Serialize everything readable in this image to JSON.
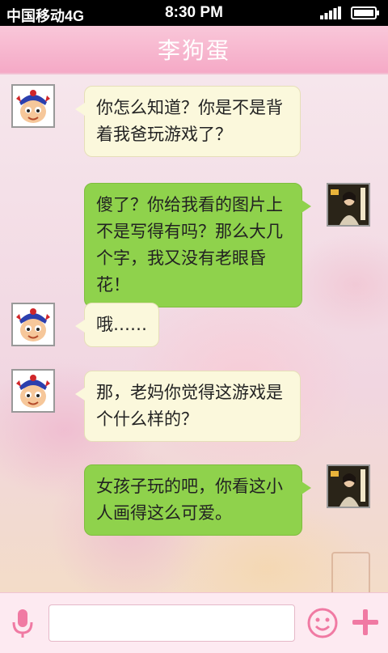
{
  "status_bar": {
    "carrier": "中国移动4G",
    "time": "8:30 PM"
  },
  "header": {
    "title": "李狗蛋"
  },
  "messages": [
    {
      "side": "in",
      "text": "你怎么知道？你是不是背着我爸玩游戏了？"
    },
    {
      "side": "out",
      "text": "傻了？你给我看的图片上不是写得有吗？那么大几个字，我又没有老眼昏花！"
    },
    {
      "side": "in",
      "text": "哦……"
    },
    {
      "side": "in",
      "text": "那，老妈你觉得这游戏是个什么样的？"
    },
    {
      "side": "out",
      "text": "女孩子玩的吧，你看这小人画得这么可爱。"
    }
  ],
  "input": {
    "value": "",
    "placeholder": ""
  },
  "icons": {
    "voice": "microphone-icon",
    "emoji": "smiley-icon",
    "more": "plus-icon"
  },
  "colors": {
    "header": "#f5a9c6",
    "incoming_bubble": "#fbf8dc",
    "outgoing_bubble": "#8fd24c",
    "accent_icons": "#f07aa3"
  }
}
